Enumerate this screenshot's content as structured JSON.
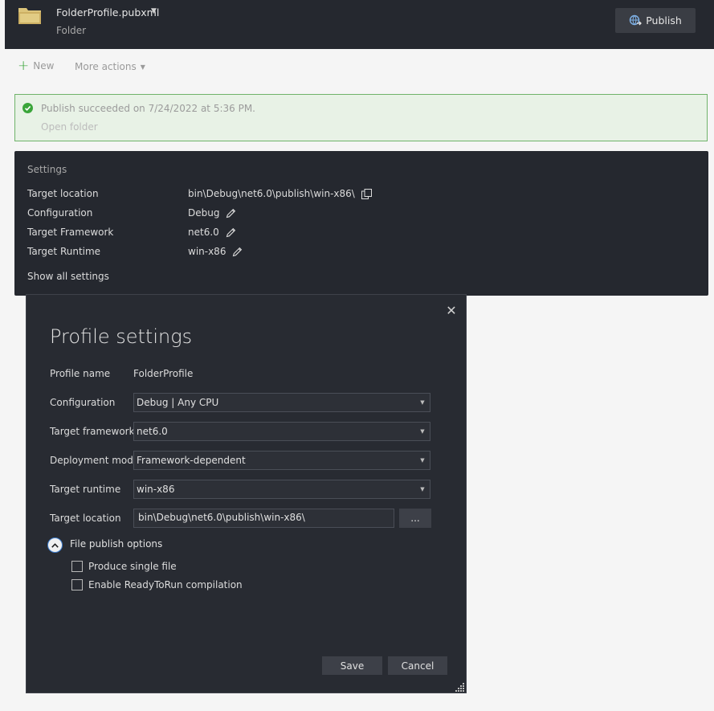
{
  "header": {
    "profile_name": "FolderProfile.pubxml",
    "profile_type": "Folder",
    "publish_label": "Publish"
  },
  "toolbar": {
    "new_label": "New",
    "more_actions_label": "More actions"
  },
  "banner": {
    "message": "Publish succeeded on 7/24/2022 at 5:36 PM.",
    "link": "Open folder"
  },
  "settings": {
    "title": "Settings",
    "rows": [
      {
        "label": "Target location",
        "value": "bin\\Debug\\net6.0\\publish\\win-x86\\",
        "icon": "copy-icon"
      },
      {
        "label": "Configuration",
        "value": "Debug",
        "icon": "edit-icon"
      },
      {
        "label": "Target Framework",
        "value": "net6.0",
        "icon": "edit-icon"
      },
      {
        "label": "Target Runtime",
        "value": "win-x86",
        "icon": "edit-icon"
      }
    ],
    "show_all": "Show all settings"
  },
  "dialog": {
    "title": "Profile settings",
    "profile_name_label": "Profile name",
    "profile_name_value": "FolderProfile",
    "configuration_label": "Configuration",
    "configuration_value": "Debug | Any CPU",
    "framework_label": "Target framework",
    "framework_value": "net6.0",
    "deployment_label": "Deployment mode",
    "deployment_value": "Framework-dependent",
    "runtime_label": "Target runtime",
    "runtime_value": "win-x86",
    "location_label": "Target location",
    "location_value": "bin\\Debug\\net6.0\\publish\\win-x86\\",
    "browse_label": "...",
    "options_title": "File publish options",
    "single_file_label": "Produce single file",
    "readytorun_label": "Enable ReadyToRun compilation",
    "save_label": "Save",
    "cancel_label": "Cancel"
  },
  "colors": {
    "dark_panel": "#25282f",
    "dialog_bg": "#282b32",
    "success_green": "#3aa53a",
    "banner_bg": "#e8f2e6",
    "banner_border": "#6fb36a"
  }
}
